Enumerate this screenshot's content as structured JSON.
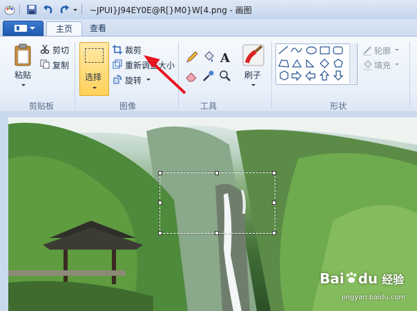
{
  "window": {
    "title": "~JPUI}J94EY0E@R[}M0}W[4.png - 画图"
  },
  "tabs": [
    {
      "label": "主页",
      "active": true
    },
    {
      "label": "查看",
      "active": false
    }
  ],
  "ribbon": {
    "clipboard": {
      "paste_label": "粘贴",
      "cut_label": "剪切",
      "copy_label": "复制",
      "group_label": "剪贴板"
    },
    "image": {
      "select_label": "选择",
      "crop_label": "裁剪",
      "resize_label": "重新调整大小",
      "rotate_label": "旋转",
      "group_label": "图像"
    },
    "tools": {
      "group_label": "工具"
    },
    "brushes": {
      "label": "刷子"
    },
    "shapes": {
      "outline_label": "轮廓",
      "fill_label": "填充",
      "group_label": "形状"
    }
  },
  "watermark": {
    "brand": "Bai",
    "brand_suffix": "du",
    "jingyan": "经验",
    "url": "jingyan.baidu.com"
  },
  "colors": {
    "accent": "#2a62b8",
    "select_highlight": "#ffd15a",
    "annotation_arrow": "#e8141e"
  }
}
